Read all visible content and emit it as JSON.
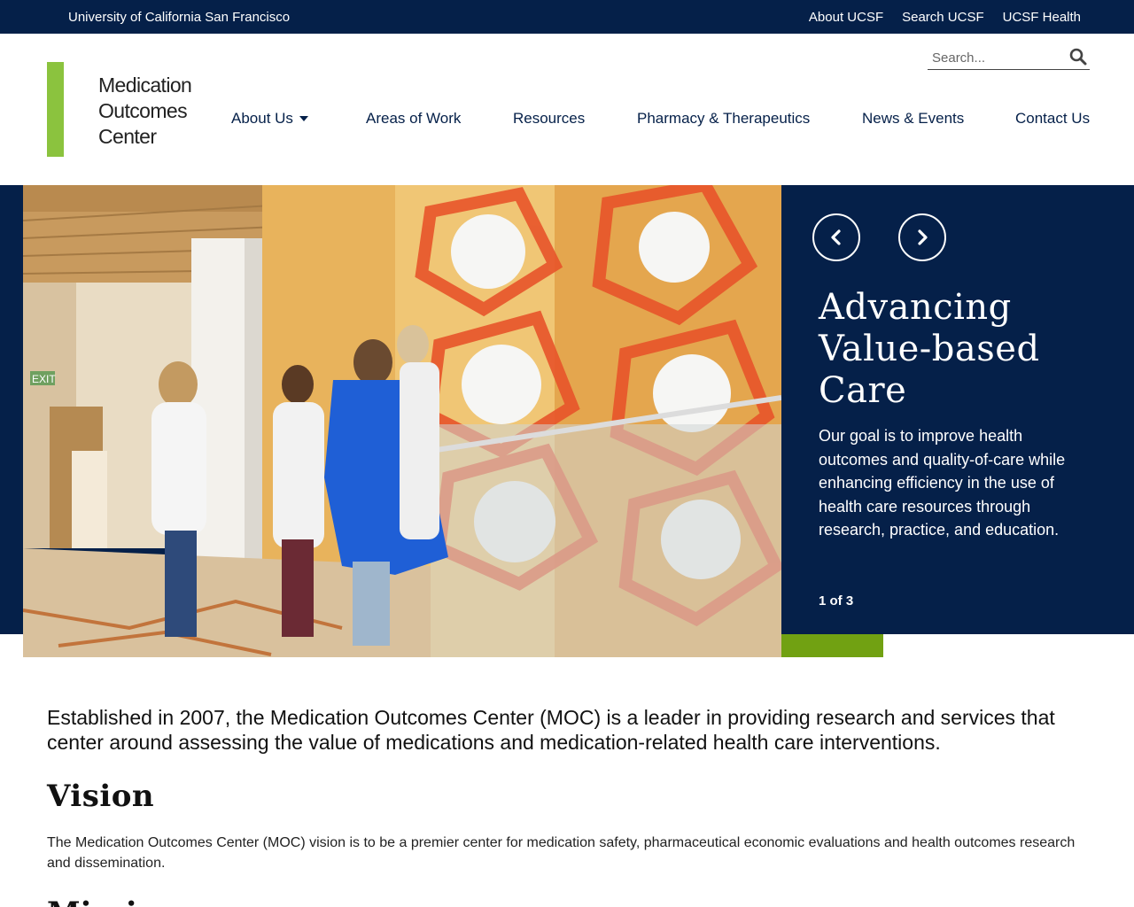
{
  "topbar": {
    "org_name": "University of California San Francisco",
    "links": [
      "About UCSF",
      "Search UCSF",
      "UCSF Health"
    ]
  },
  "logo": {
    "line1": "Medication",
    "line2": "Outcomes",
    "line3": "Center",
    "bar_color": "#8bc33e"
  },
  "search": {
    "placeholder": "Search...",
    "icon": "search-icon"
  },
  "nav": {
    "about": "About Us",
    "areas": "Areas of Work",
    "resources": "Resources",
    "pharmacy": "Pharmacy & Therapeutics",
    "news": "News & Events",
    "contact": "Contact Us"
  },
  "hero": {
    "title": "Advancing Value-based Care",
    "text": "Our goal is to improve health outcomes and quality-of-care while enhancing efficiency in the use of health care resources through research, practice, and education.",
    "counter": "1 of 3",
    "prev_icon": "chevron-left-icon",
    "next_icon": "chevron-right-icon",
    "image_sign": "EXIT"
  },
  "content": {
    "intro": "Established in 2007, the Medication Outcomes Center (MOC) is a leader in providing research and services that center around assessing the value of medications and medication-related health care interventions.",
    "vision_heading": "Vision",
    "vision_text": "The Medication Outcomes Center (MOC) vision is to be a premier center for medication safety, pharmaceutical economic evaluations and health outcomes research and dissemination.",
    "mission_heading": "Mission"
  },
  "colors": {
    "navy": "#052049",
    "green_accent": "#71a112",
    "logo_green": "#8bc33e"
  }
}
